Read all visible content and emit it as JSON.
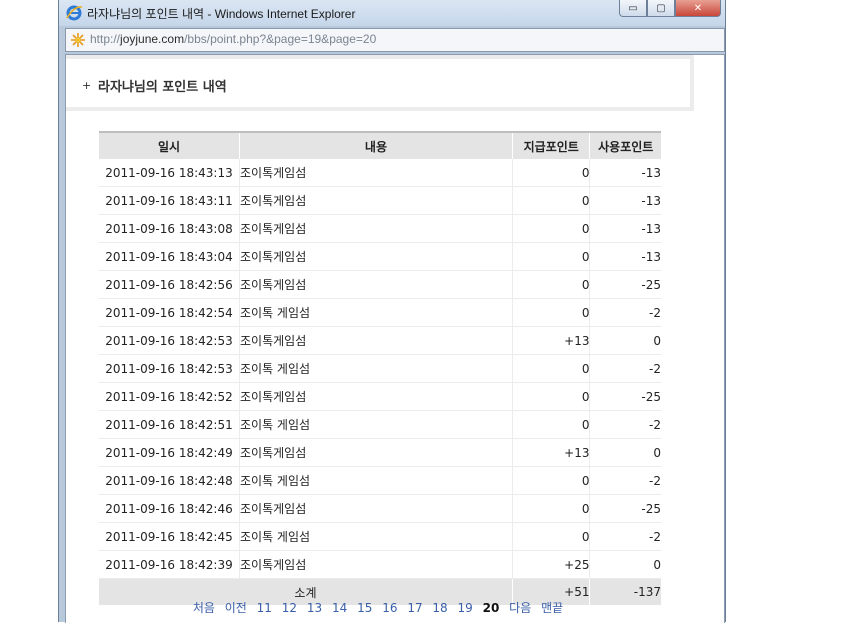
{
  "window": {
    "title": "라자냐님의 포인트 내역 - Windows Internet Explorer",
    "url_prefix": "http://",
    "url_domain": "joyjune.com",
    "url_path": "/bbs/point.php?&page=19&page=20",
    "minimize_label": "▭",
    "maximize_label": "▢",
    "close_label": "✕"
  },
  "header": {
    "plus": "+",
    "title": "라자냐님의 포인트 내역"
  },
  "table": {
    "columns": [
      "일시",
      "내용",
      "지급포인트",
      "사용포인트"
    ],
    "rows": [
      {
        "date": "2011-09-16 18:43:13",
        "desc": "조이톡게임섬",
        "give": "0",
        "use": "-13"
      },
      {
        "date": "2011-09-16 18:43:11",
        "desc": "조이톡게임섬",
        "give": "0",
        "use": "-13"
      },
      {
        "date": "2011-09-16 18:43:08",
        "desc": "조이톡게임섬",
        "give": "0",
        "use": "-13"
      },
      {
        "date": "2011-09-16 18:43:04",
        "desc": "조이톡게임섬",
        "give": "0",
        "use": "-13"
      },
      {
        "date": "2011-09-16 18:42:56",
        "desc": "조이톡게임섬",
        "give": "0",
        "use": "-25"
      },
      {
        "date": "2011-09-16 18:42:54",
        "desc": "조이톡 게임섬",
        "give": "0",
        "use": "-2"
      },
      {
        "date": "2011-09-16 18:42:53",
        "desc": "조이톡게임섬",
        "give": "+13",
        "use": "0"
      },
      {
        "date": "2011-09-16 18:42:53",
        "desc": "조이톡 게임섬",
        "give": "0",
        "use": "-2"
      },
      {
        "date": "2011-09-16 18:42:52",
        "desc": "조이톡게임섬",
        "give": "0",
        "use": "-25"
      },
      {
        "date": "2011-09-16 18:42:51",
        "desc": "조이톡 게임섬",
        "give": "0",
        "use": "-2"
      },
      {
        "date": "2011-09-16 18:42:49",
        "desc": "조이톡게임섬",
        "give": "+13",
        "use": "0"
      },
      {
        "date": "2011-09-16 18:42:48",
        "desc": "조이톡 게임섬",
        "give": "0",
        "use": "-2"
      },
      {
        "date": "2011-09-16 18:42:46",
        "desc": "조이톡게임섬",
        "give": "0",
        "use": "-25"
      },
      {
        "date": "2011-09-16 18:42:45",
        "desc": "조이톡 게임섬",
        "give": "0",
        "use": "-2"
      },
      {
        "date": "2011-09-16 18:42:39",
        "desc": "조이톡게임섬",
        "give": "+25",
        "use": "0"
      }
    ],
    "summary": {
      "label": "소계",
      "give": "+51",
      "use": "-137"
    }
  },
  "pagination": {
    "first": "처음",
    "prev": "이전",
    "pages": [
      "11",
      "12",
      "13",
      "14",
      "15",
      "16",
      "17",
      "18",
      "19"
    ],
    "current": "20",
    "next": "다음",
    "last": "맨끝"
  }
}
